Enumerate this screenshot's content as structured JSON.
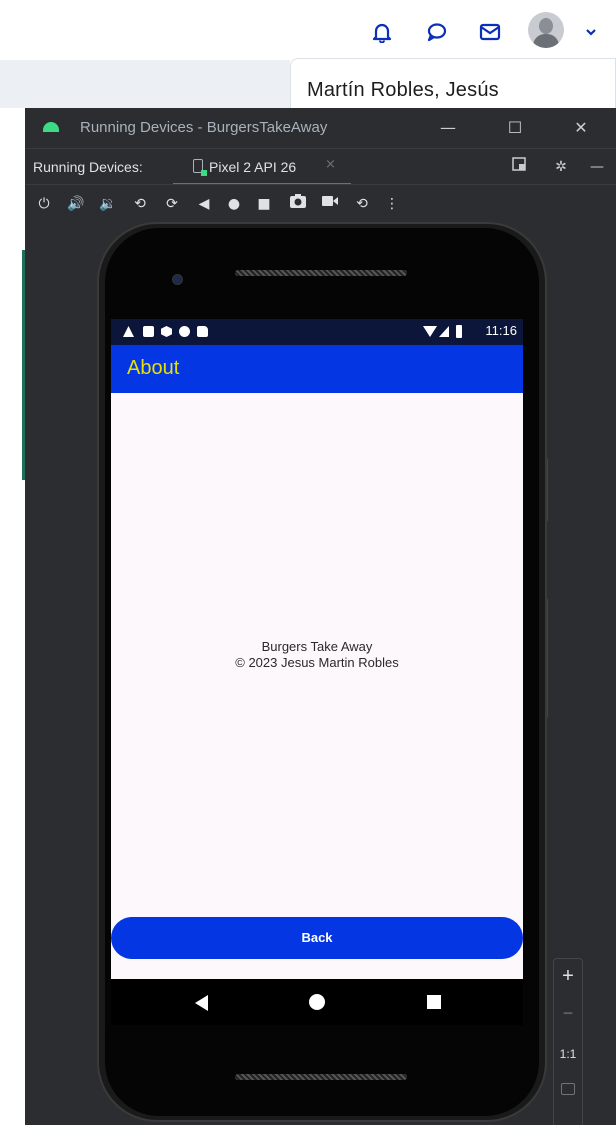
{
  "header": {
    "user_name": "Martín Robles, Jesús",
    "icons": [
      "bell-icon",
      "chat-icon",
      "mail-icon",
      "avatar",
      "chevron-down-icon"
    ]
  },
  "window": {
    "title": "Running Devices - BurgersTakeAway",
    "running_devices_label": "Running Devices:",
    "device_tab": "Pixel 2 API 26",
    "tab_close": "×",
    "toolbar_icons": [
      "power-icon",
      "volume-up-icon",
      "volume-down-icon",
      "rotate-left-icon",
      "rotate-right-icon",
      "back-icon",
      "home-icon",
      "overview-icon",
      "screenshot-icon",
      "screen-record-icon",
      "snapshot-icon",
      "more-icon"
    ]
  },
  "phone": {
    "status_time": "11:16",
    "app_title": "About",
    "about_line1": "Burgers Take Away",
    "about_line2": "© 2023 Jesus Martin Robles",
    "back_button": "Back"
  },
  "zoom": {
    "plus": "+",
    "minus": "−",
    "one_to_one": "1:1"
  },
  "colors": {
    "app_bar": "#0437e3",
    "app_title": "#e8e000",
    "ide_background": "#2b2d30",
    "accent": "#3574f0"
  }
}
